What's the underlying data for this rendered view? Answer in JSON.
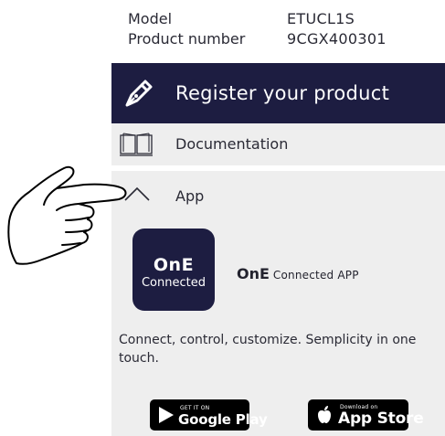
{
  "specs": {
    "model_label": "Model",
    "model_value": "ETUCL1S",
    "product_number_label": "Product number",
    "product_number_value": "9CGX400301"
  },
  "register": {
    "label": "Register your product",
    "icon": "pen-icon"
  },
  "documentation": {
    "label": "Documentation",
    "icon": "book-icon"
  },
  "app_section": {
    "label": "App",
    "icon": "chevron-up-icon",
    "tile_line1": "OnE",
    "tile_line2": "Connected",
    "app_name_bold": "OnE",
    "app_name_rest": "Connected APP",
    "tagline": "Connect, control, customize. Semplicity in one touch."
  },
  "stores": {
    "google_small": "GET IT ON",
    "google_big": "Google Play",
    "apple_small": "Download on",
    "apple_big": "App Store"
  },
  "colors": {
    "navy": "#1d1d41",
    "panel_bg": "#eeeeee"
  }
}
